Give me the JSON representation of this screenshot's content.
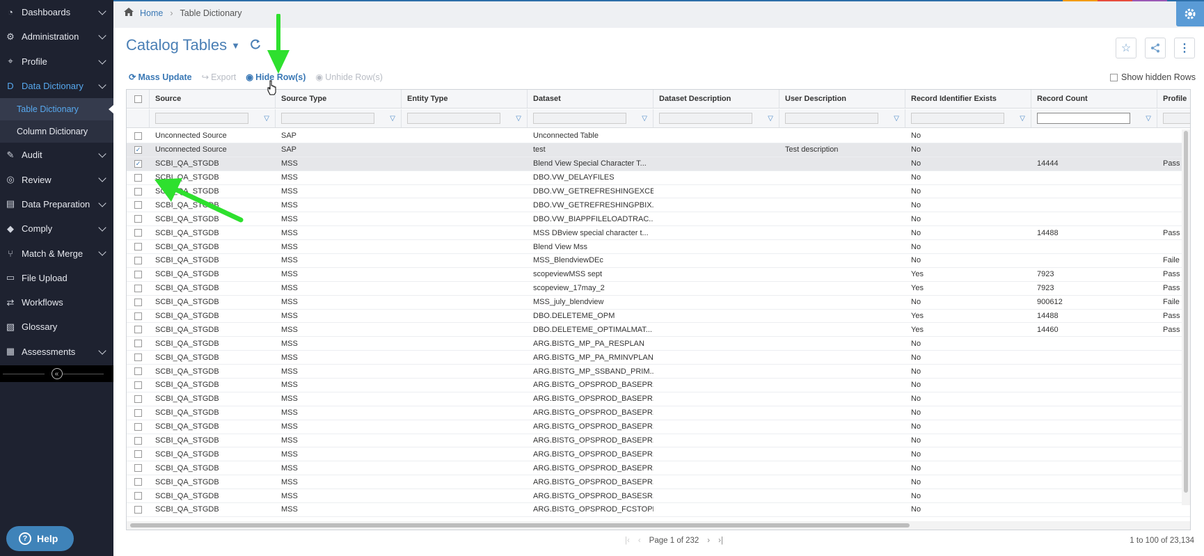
{
  "colors": {
    "accent": "#3a78b5",
    "sidebar_bg": "#1e2230",
    "active_nav": "#57a8ee",
    "arrow": "#2ee02e"
  },
  "sidebar": {
    "items": [
      {
        "label": "Dashboards",
        "icon": "dashboard-icon",
        "chevron": true
      },
      {
        "label": "Administration",
        "icon": "gears-icon",
        "chevron": true
      },
      {
        "label": "Profile",
        "icon": "crosshair-icon",
        "chevron": true
      },
      {
        "label": "Data Dictionary",
        "icon": "dictionary-icon",
        "chevron": true,
        "active": true
      },
      {
        "label": "Audit",
        "icon": "edit-icon",
        "chevron": true
      },
      {
        "label": "Review",
        "icon": "review-icon",
        "chevron": true
      },
      {
        "label": "Data Preparation",
        "icon": "data-prep-icon",
        "chevron": true
      },
      {
        "label": "Comply",
        "icon": "tag-icon",
        "chevron": true
      },
      {
        "label": "Match & Merge",
        "icon": "merge-icon",
        "chevron": true
      },
      {
        "label": "File Upload",
        "icon": "file-icon",
        "chevron": false
      },
      {
        "label": "Workflows",
        "icon": "workflow-icon",
        "chevron": false
      },
      {
        "label": "Glossary",
        "icon": "glossary-icon",
        "chevron": false
      },
      {
        "label": "Assessments",
        "icon": "assessment-icon",
        "chevron": true
      }
    ],
    "subitems": [
      {
        "label": "Table Dictionary",
        "active": true
      },
      {
        "label": "Column Dictionary",
        "active": false
      }
    ],
    "help_label": "Help"
  },
  "breadcrumb": {
    "home": "Home",
    "current": "Table Dictionary"
  },
  "page": {
    "title": "Catalog Tables"
  },
  "toolbar": {
    "mass_update": "Mass Update",
    "export": "Export",
    "hide_rows": "Hide Row(s)",
    "unhide_rows": "Unhide Row(s)",
    "show_hidden": "Show hidden Rows"
  },
  "table": {
    "columns": [
      "Source",
      "Source Type",
      "Entity Type",
      "Dataset",
      "Dataset Description",
      "User Description",
      "Record Identifier Exists",
      "Record Count",
      "Profile"
    ],
    "rows": [
      {
        "checked": false,
        "selected": false,
        "cells": [
          "Unconnected Source",
          "SAP",
          "",
          "Unconnected Table",
          "",
          "",
          "No",
          "",
          ""
        ]
      },
      {
        "checked": true,
        "selected": true,
        "cells": [
          "Unconnected Source",
          "SAP",
          "",
          "test",
          "",
          "Test description",
          "No",
          "",
          ""
        ]
      },
      {
        "checked": true,
        "selected": true,
        "cells": [
          "SCBI_QA_STGDB",
          "MSS",
          "",
          "Blend View Special Character T...",
          "",
          "",
          "No",
          "14444",
          "Pass"
        ]
      },
      {
        "checked": false,
        "selected": false,
        "cells": [
          "SCBI_QA_STGDB",
          "MSS",
          "",
          "DBO.VW_DELAYFILES",
          "",
          "",
          "No",
          "",
          ""
        ]
      },
      {
        "checked": false,
        "selected": false,
        "cells": [
          "SCBI_QA_STGDB",
          "MSS",
          "",
          "DBO.VW_GETREFRESHINGEXCE...",
          "",
          "",
          "No",
          "",
          ""
        ]
      },
      {
        "checked": false,
        "selected": false,
        "cells": [
          "SCBI_QA_STGDB",
          "MSS",
          "",
          "DBO.VW_GETREFRESHINGPBIX...",
          "",
          "",
          "No",
          "",
          ""
        ]
      },
      {
        "checked": false,
        "selected": false,
        "cells": [
          "SCBI_QA_STGDB",
          "MSS",
          "",
          "DBO.VW_BIAPPFILELOADTRAC...",
          "",
          "",
          "No",
          "",
          ""
        ]
      },
      {
        "checked": false,
        "selected": false,
        "cells": [
          "SCBI_QA_STGDB",
          "MSS",
          "",
          "MSS DBview special character t...",
          "",
          "",
          "No",
          "14488",
          "Pass"
        ]
      },
      {
        "checked": false,
        "selected": false,
        "cells": [
          "SCBI_QA_STGDB",
          "MSS",
          "",
          "Blend View Mss",
          "",
          "",
          "No",
          "",
          ""
        ]
      },
      {
        "checked": false,
        "selected": false,
        "cells": [
          "SCBI_QA_STGDB",
          "MSS",
          "",
          "MSS_BlendviewDEc",
          "",
          "",
          "No",
          "",
          "Faile"
        ]
      },
      {
        "checked": false,
        "selected": false,
        "cells": [
          "SCBI_QA_STGDB",
          "MSS",
          "",
          "scopeviewMSS sept",
          "",
          "",
          "Yes",
          "7923",
          "Pass"
        ]
      },
      {
        "checked": false,
        "selected": false,
        "cells": [
          "SCBI_QA_STGDB",
          "MSS",
          "",
          "scopeview_17may_2",
          "",
          "",
          "Yes",
          "7923",
          "Pass"
        ]
      },
      {
        "checked": false,
        "selected": false,
        "cells": [
          "SCBI_QA_STGDB",
          "MSS",
          "",
          "MSS_july_blendview",
          "",
          "",
          "No",
          "900612",
          "Faile"
        ]
      },
      {
        "checked": false,
        "selected": false,
        "cells": [
          "SCBI_QA_STGDB",
          "MSS",
          "",
          "DBO.DELETEME_OPM",
          "",
          "",
          "Yes",
          "14488",
          "Pass"
        ]
      },
      {
        "checked": false,
        "selected": false,
        "cells": [
          "SCBI_QA_STGDB",
          "MSS",
          "",
          "DBO.DELETEME_OPTIMALMAT...",
          "",
          "",
          "Yes",
          "14460",
          "Pass"
        ]
      },
      {
        "checked": false,
        "selected": false,
        "cells": [
          "SCBI_QA_STGDB",
          "MSS",
          "",
          "ARG.BISTG_MP_PA_RESPLAN",
          "",
          "",
          "No",
          "",
          ""
        ]
      },
      {
        "checked": false,
        "selected": false,
        "cells": [
          "SCBI_QA_STGDB",
          "MSS",
          "",
          "ARG.BISTG_MP_PA_RMINVPLAN",
          "",
          "",
          "No",
          "",
          ""
        ]
      },
      {
        "checked": false,
        "selected": false,
        "cells": [
          "SCBI_QA_STGDB",
          "MSS",
          "",
          "ARG.BISTG_MP_SSBAND_PRIM...",
          "",
          "",
          "No",
          "",
          ""
        ]
      },
      {
        "checked": false,
        "selected": false,
        "cells": [
          "SCBI_QA_STGDB",
          "MSS",
          "",
          "ARG.BISTG_OPSPROD_BASEPR...",
          "",
          "",
          "No",
          "",
          ""
        ]
      },
      {
        "checked": false,
        "selected": false,
        "cells": [
          "SCBI_QA_STGDB",
          "MSS",
          "",
          "ARG.BISTG_OPSPROD_BASEPR...",
          "",
          "",
          "No",
          "",
          ""
        ]
      },
      {
        "checked": false,
        "selected": false,
        "cells": [
          "SCBI_QA_STGDB",
          "MSS",
          "",
          "ARG.BISTG_OPSPROD_BASEPR...",
          "",
          "",
          "No",
          "",
          ""
        ]
      },
      {
        "checked": false,
        "selected": false,
        "cells": [
          "SCBI_QA_STGDB",
          "MSS",
          "",
          "ARG.BISTG_OPSPROD_BASEPR...",
          "",
          "",
          "No",
          "",
          ""
        ]
      },
      {
        "checked": false,
        "selected": false,
        "cells": [
          "SCBI_QA_STGDB",
          "MSS",
          "",
          "ARG.BISTG_OPSPROD_BASEPR...",
          "",
          "",
          "No",
          "",
          ""
        ]
      },
      {
        "checked": false,
        "selected": false,
        "cells": [
          "SCBI_QA_STGDB",
          "MSS",
          "",
          "ARG.BISTG_OPSPROD_BASEPR...",
          "",
          "",
          "No",
          "",
          ""
        ]
      },
      {
        "checked": false,
        "selected": false,
        "cells": [
          "SCBI_QA_STGDB",
          "MSS",
          "",
          "ARG.BISTG_OPSPROD_BASEPR...",
          "",
          "",
          "No",
          "",
          ""
        ]
      },
      {
        "checked": false,
        "selected": false,
        "cells": [
          "SCBI_QA_STGDB",
          "MSS",
          "",
          "ARG.BISTG_OPSPROD_BASEPR...",
          "",
          "",
          "No",
          "",
          ""
        ]
      },
      {
        "checked": false,
        "selected": false,
        "cells": [
          "SCBI_QA_STGDB",
          "MSS",
          "",
          "ARG.BISTG_OPSPROD_BASESR...",
          "",
          "",
          "No",
          "",
          ""
        ]
      },
      {
        "checked": false,
        "selected": false,
        "cells": [
          "SCBI_QA_STGDB",
          "MSS",
          "",
          "ARG.BISTG_OPSPROD_FCSTOPE...",
          "",
          "",
          "No",
          "",
          ""
        ]
      }
    ]
  },
  "pager": {
    "page_text": "Page 1 of 232",
    "range_text": "1 to 100 of 23,134"
  }
}
